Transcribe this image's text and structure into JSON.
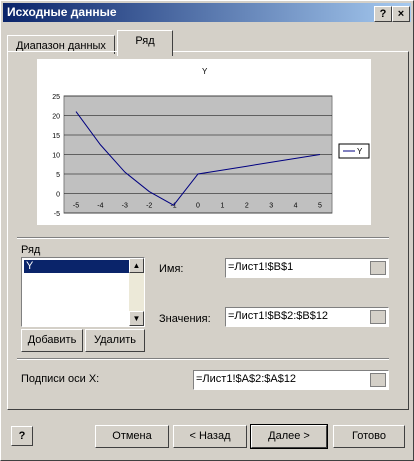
{
  "window": {
    "title": "Исходные данные",
    "help_btn": "?",
    "close_btn": "×"
  },
  "tabs": [
    {
      "label": "Диапазон данных"
    },
    {
      "label": "Ряд"
    }
  ],
  "chart": {
    "title": "Y",
    "legend": "Y",
    "y_ticks": [
      "25",
      "20",
      "15",
      "10",
      "5",
      "0",
      "-5"
    ],
    "x_ticks": [
      "-5",
      "-4",
      "-3",
      "-2",
      "-1",
      "0",
      "1",
      "2",
      "3",
      "4",
      "5"
    ]
  },
  "chart_data": {
    "type": "line",
    "title": "Y",
    "x": [
      -5,
      -4,
      -3,
      -2,
      -1,
      0,
      1,
      2,
      3,
      4,
      5
    ],
    "series": [
      {
        "name": "Y",
        "values": [
          21,
          12.5,
          5.5,
          0.5,
          -3,
          5,
          6,
          7,
          8,
          9,
          10
        ]
      }
    ],
    "ylim": [
      -5,
      25
    ],
    "grid": true,
    "legend_position": "right",
    "plot_bg": "#c0c0c0",
    "line_color": "#000080"
  },
  "series_group": {
    "label": "Ряд",
    "items": [
      "Y"
    ],
    "add_button": "Добавить",
    "remove_button": "Удалить"
  },
  "fields": {
    "name_label": "Имя:",
    "name_value": "=Лист1!$B$1",
    "values_label": "Значения:",
    "values_value": "=Лист1!$B$2:$B$12",
    "xaxis_label": "Подписи оси X:",
    "xaxis_value": "=Лист1!$A$2:$A$12"
  },
  "footer": {
    "cancel": "Отмена",
    "back": "< Назад",
    "next": "Далее >",
    "finish": "Готово"
  }
}
